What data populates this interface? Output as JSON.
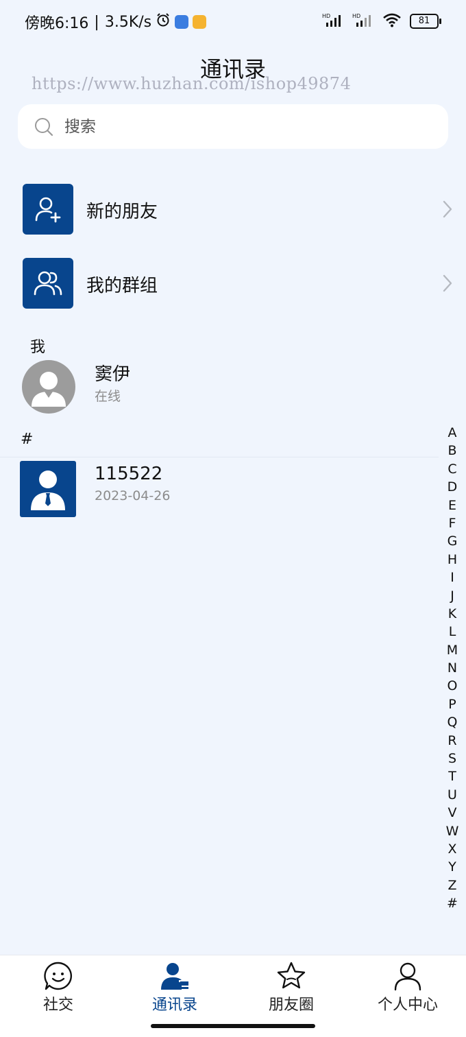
{
  "status_bar": {
    "time": "傍晚6:16",
    "network_speed": "3.5K/s",
    "battery": "81",
    "signal_label_1": "HD",
    "signal_label_2": "HD"
  },
  "header": {
    "title": "通讯录",
    "watermark": "https://www.huzhan.com/ishop49874"
  },
  "search": {
    "placeholder": "搜索"
  },
  "entries": [
    {
      "label": "新的朋友",
      "icon": "add-user-icon"
    },
    {
      "label": "我的群组",
      "icon": "group-icon"
    }
  ],
  "me_section": {
    "header": "我",
    "name": "窦伊",
    "status": "在线"
  },
  "contacts_section": {
    "header": "#",
    "contacts": [
      {
        "name": "115522",
        "subtitle": "2023-04-26"
      }
    ]
  },
  "alphabet_index": [
    "A",
    "B",
    "C",
    "D",
    "E",
    "F",
    "G",
    "H",
    "I",
    "J",
    "K",
    "L",
    "M",
    "N",
    "O",
    "P",
    "Q",
    "R",
    "S",
    "T",
    "U",
    "V",
    "W",
    "X",
    "Y",
    "Z",
    "#"
  ],
  "bottom_nav": {
    "tabs": [
      {
        "label": "社交",
        "icon": "smile-chat-icon",
        "active": false
      },
      {
        "label": "通讯录",
        "icon": "contacts-icon",
        "active": true
      },
      {
        "label": "朋友圈",
        "icon": "star-icon",
        "active": false
      },
      {
        "label": "个人中心",
        "icon": "person-icon",
        "active": false
      }
    ]
  },
  "colors": {
    "background": "#f0f5fd",
    "accent": "#08458d",
    "avatar_gray": "#9c9c9c",
    "subtext": "#8c8c8c"
  }
}
